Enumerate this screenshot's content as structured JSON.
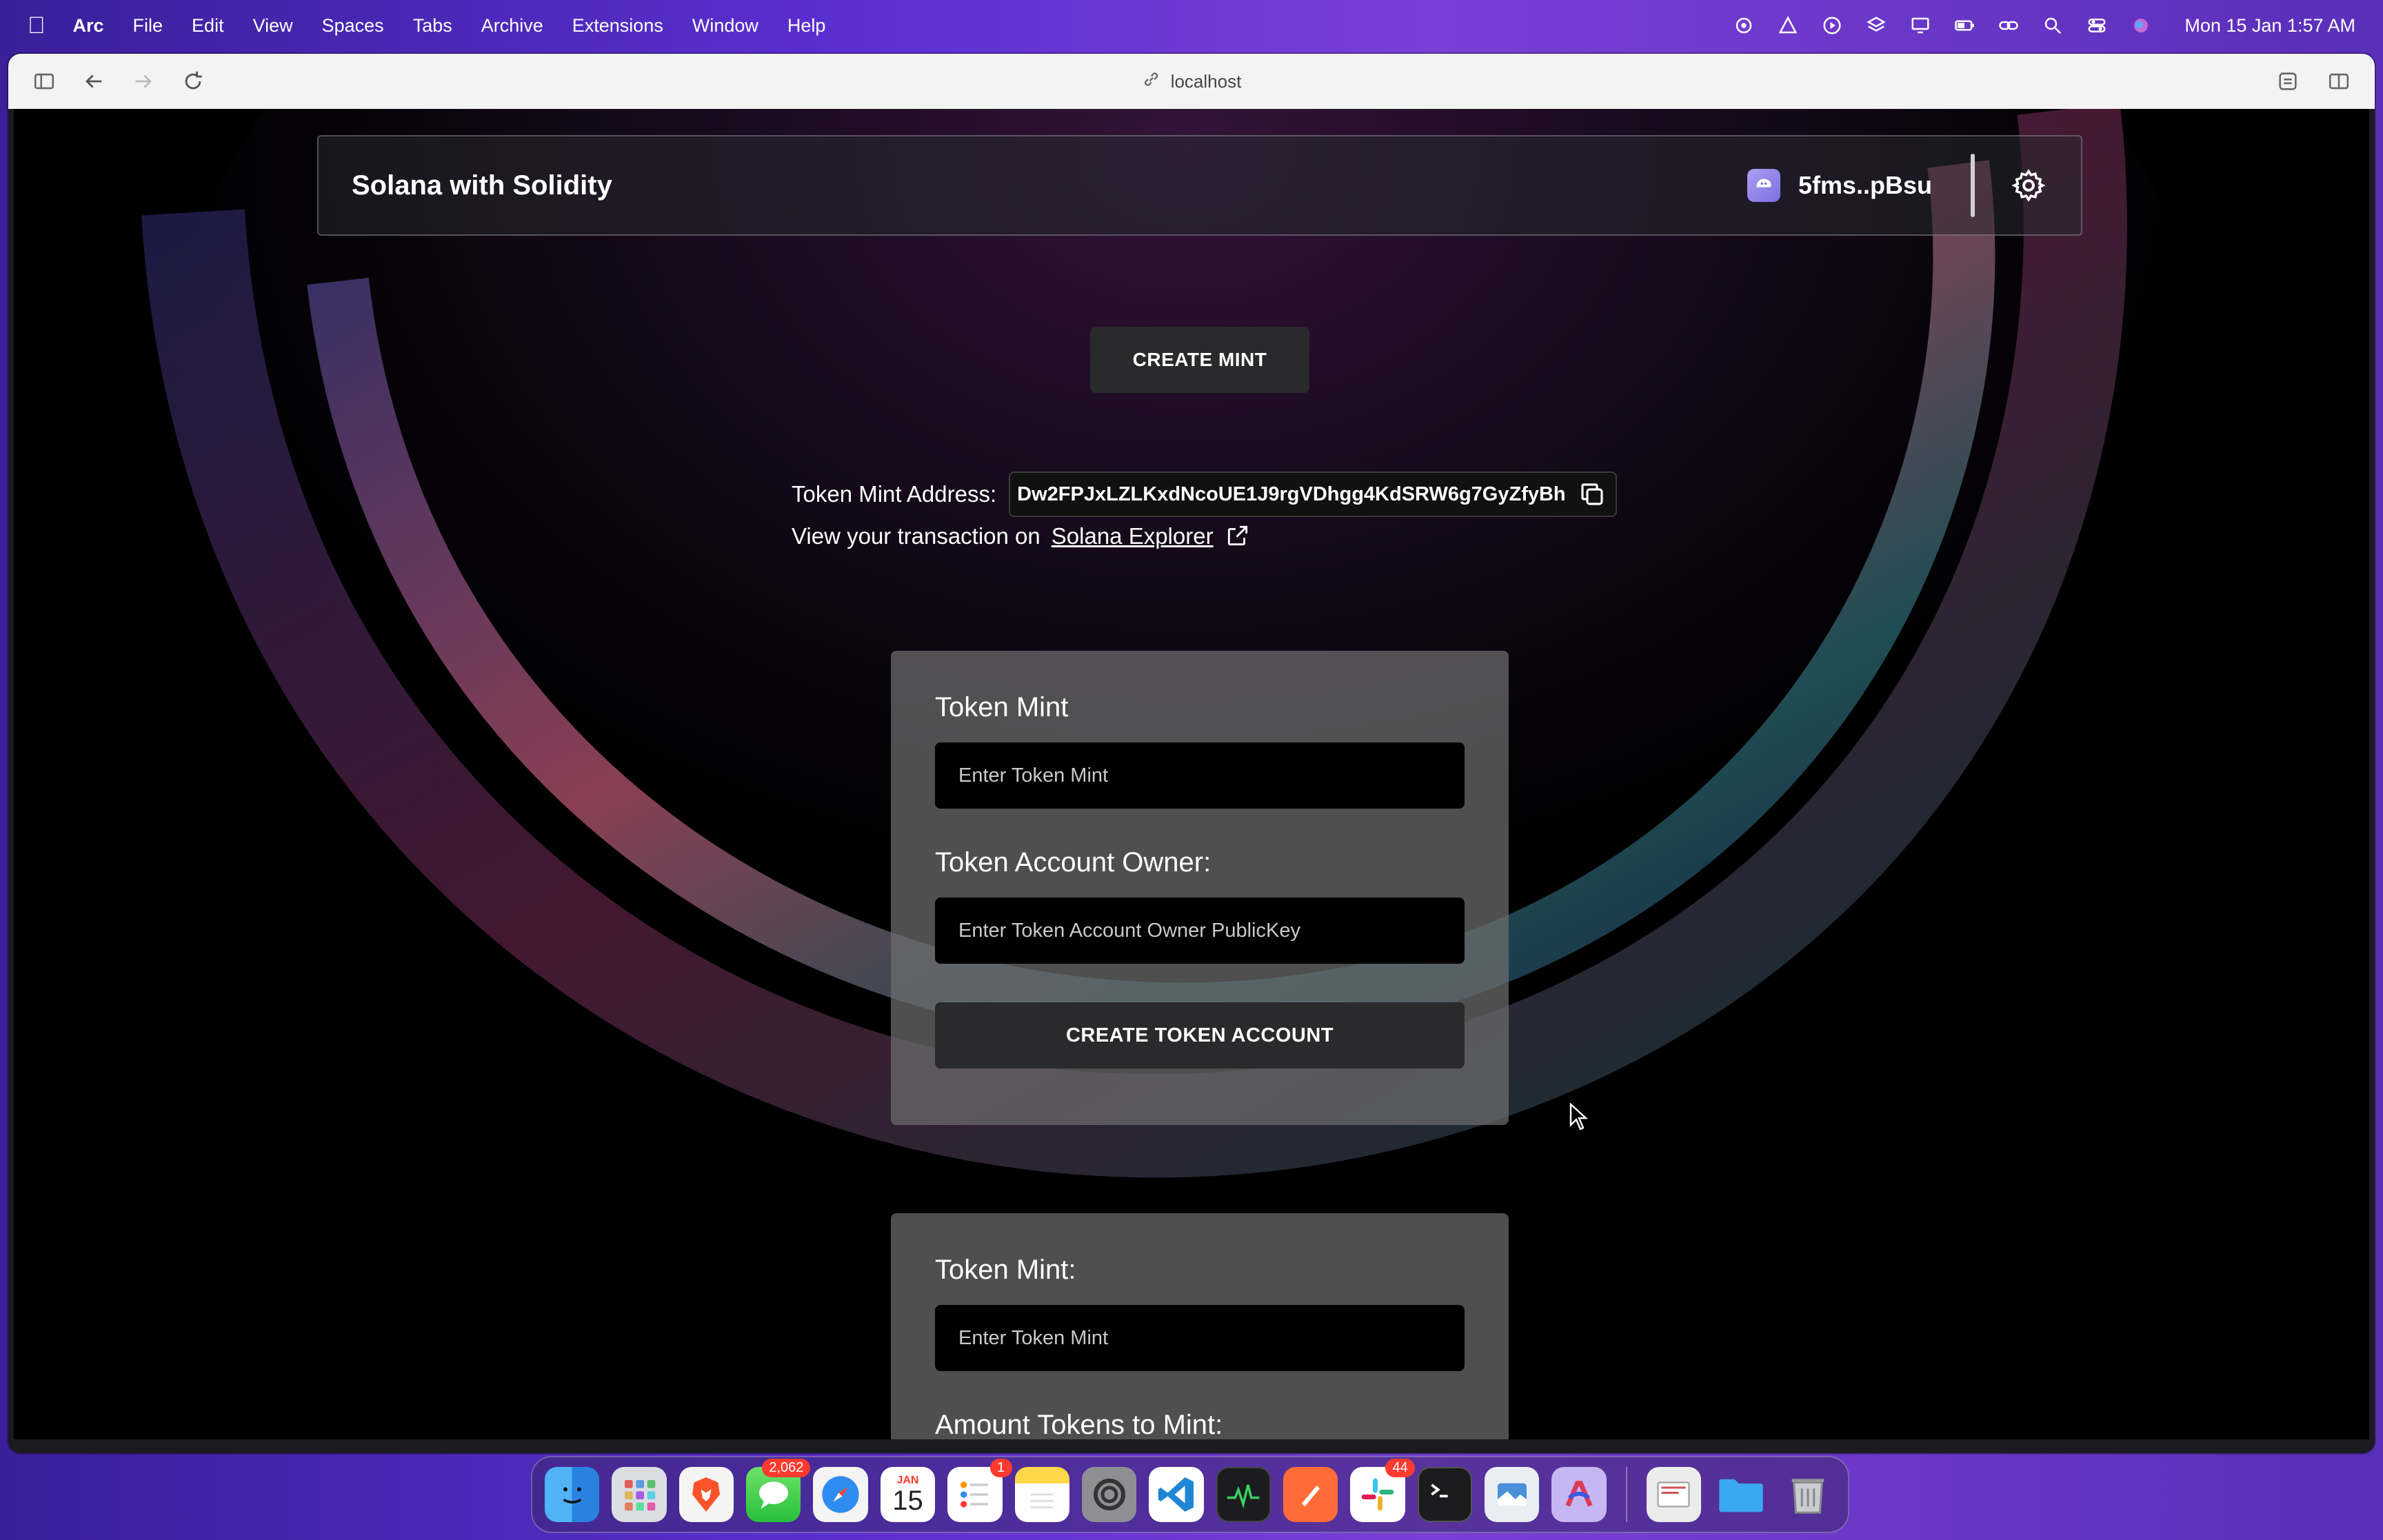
{
  "menubar": {
    "app_name": "Arc",
    "items": [
      "File",
      "Edit",
      "View",
      "Spaces",
      "Tabs",
      "Archive",
      "Extensions",
      "Window",
      "Help"
    ],
    "clock": "Mon 15 Jan  1:57 AM"
  },
  "browser": {
    "address": "localhost"
  },
  "navbar": {
    "title": "Solana with Solidity",
    "wallet": "5fms..pBsu"
  },
  "mint": {
    "button_label": "CREATE MINT",
    "address_label": "Token Mint Address:",
    "address_value": "Dw2FPJxLZLKxdNcoUE1J9rgVDhgg4KdSRW6g7GyZfyBh",
    "tx_text": "View your transaction on",
    "explorer_link": "Solana Explorer"
  },
  "token_account_card": {
    "mint_label": "Token Mint",
    "mint_placeholder": "Enter Token Mint",
    "owner_label": "Token Account Owner:",
    "owner_placeholder": "Enter Token Account Owner PublicKey",
    "button_label": "CREATE TOKEN ACCOUNT"
  },
  "mint_tokens_card": {
    "mint_label": "Token Mint:",
    "mint_placeholder": "Enter Token Mint",
    "amount_label": "Amount Tokens to Mint:"
  },
  "dock": {
    "messages_badge": "2,062",
    "calendar_month": "JAN",
    "calendar_day": "15",
    "reminders_badge": "1",
    "slack_badge": "44"
  },
  "colors": {
    "card_bg": "#6e6e6e",
    "button_bg": "#2a2a2c",
    "menubar_accent": "#5b2fd0"
  }
}
